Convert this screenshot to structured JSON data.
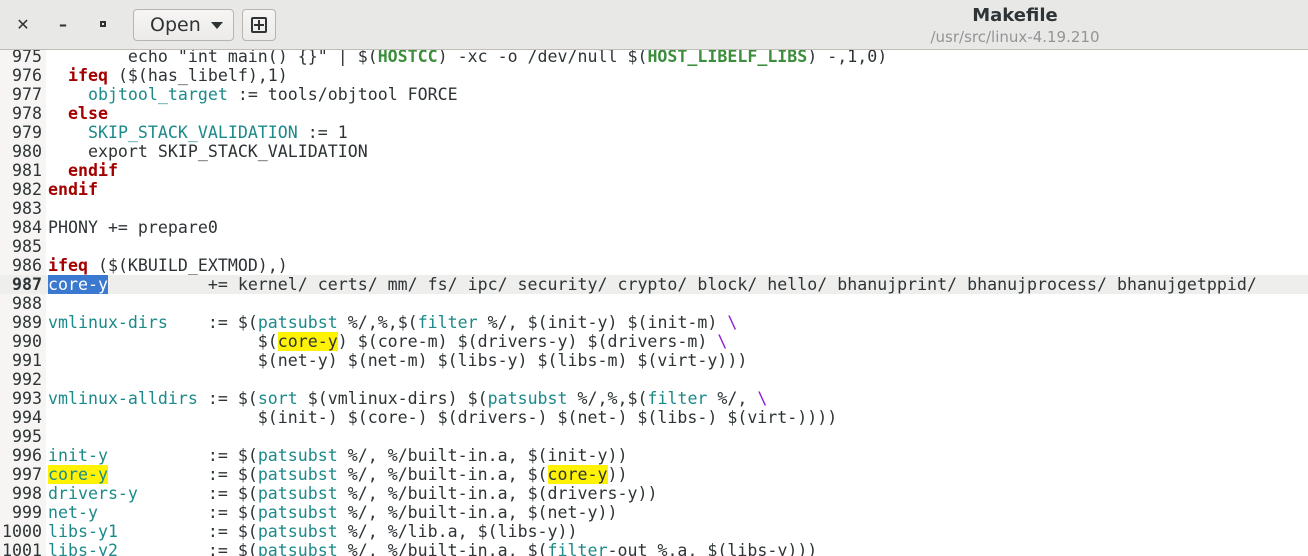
{
  "window": {
    "title": "Makefile",
    "subtitle": "/usr/src/linux-4.19.210",
    "close_symbol": "✕",
    "minimize_symbol": "–",
    "open_label": "Open",
    "icons": [
      "close-icon",
      "minimize-icon",
      "maximize-icon",
      "chevron-down-icon",
      "new-document-icon"
    ]
  },
  "editor": {
    "current_line": "987",
    "lines": [
      {
        "n": "975",
        "parts": [
          {
            "t": "        echo \"int main() {}\" | $("
          },
          {
            "t": "HOSTCC",
            "c": "mac"
          },
          {
            "t": ") -xc -o /dev/null $("
          },
          {
            "t": "HOST_LIBELF_LIBS",
            "c": "mac"
          },
          {
            "t": ") -,1,0)"
          }
        ]
      },
      {
        "n": "976",
        "parts": [
          {
            "t": "  "
          },
          {
            "t": "ifeq",
            "c": "kw"
          },
          {
            "t": " ($(has_libelf),1)"
          }
        ]
      },
      {
        "n": "977",
        "parts": [
          {
            "t": "    "
          },
          {
            "t": "objtool_target",
            "c": "var"
          },
          {
            "t": " := tools/objtool FORCE"
          }
        ]
      },
      {
        "n": "978",
        "parts": [
          {
            "t": "  "
          },
          {
            "t": "else",
            "c": "kw"
          }
        ]
      },
      {
        "n": "979",
        "parts": [
          {
            "t": "    "
          },
          {
            "t": "SKIP_STACK_VALIDATION",
            "c": "var"
          },
          {
            "t": " := 1"
          }
        ]
      },
      {
        "n": "980",
        "parts": [
          {
            "t": "    export SKIP_STACK_VALIDATION"
          }
        ]
      },
      {
        "n": "981",
        "parts": [
          {
            "t": "  "
          },
          {
            "t": "endif",
            "c": "kw"
          }
        ]
      },
      {
        "n": "982",
        "parts": [
          {
            "t": "endif",
            "c": "kw"
          }
        ]
      },
      {
        "n": "983",
        "parts": []
      },
      {
        "n": "984",
        "parts": [
          {
            "t": "PHONY += prepare0"
          }
        ]
      },
      {
        "n": "985",
        "parts": []
      },
      {
        "n": "986",
        "parts": [
          {
            "t": "ifeq",
            "c": "kw"
          },
          {
            "t": " ($(KBUILD_EXTMOD),)"
          }
        ]
      },
      {
        "n": "987",
        "parts": [
          {
            "t": "core-y",
            "c": "sel"
          },
          {
            "t": "          += kernel/ certs/ mm/ fs/ ipc/ security/ crypto/ block/ hello/ bhanujprint/ bhanujprocess/ bhanujgetppid/"
          }
        ]
      },
      {
        "n": "988",
        "parts": []
      },
      {
        "n": "989",
        "parts": [
          {
            "t": "vmlinux-dirs",
            "c": "var"
          },
          {
            "t": "    := $("
          },
          {
            "t": "patsubst",
            "c": "fn"
          },
          {
            "t": " %/,%,$("
          },
          {
            "t": "filter",
            "c": "fn"
          },
          {
            "t": " %/, $(init-y) $(init-m) "
          },
          {
            "t": "\\",
            "c": "bs"
          }
        ]
      },
      {
        "n": "990",
        "parts": [
          {
            "t": "                     $("
          },
          {
            "t": "core-y",
            "c": "hl"
          },
          {
            "t": ") $(core-m) $(drivers-y) $(drivers-m) "
          },
          {
            "t": "\\",
            "c": "bs"
          }
        ]
      },
      {
        "n": "991",
        "parts": [
          {
            "t": "                     $(net-y) $(net-m) $(libs-y) $(libs-m) $(virt-y)))"
          }
        ]
      },
      {
        "n": "992",
        "parts": []
      },
      {
        "n": "993",
        "parts": [
          {
            "t": "vmlinux-alldirs",
            "c": "var"
          },
          {
            "t": " := $("
          },
          {
            "t": "sort",
            "c": "fn"
          },
          {
            "t": " $(vmlinux-dirs) $("
          },
          {
            "t": "patsubst",
            "c": "fn"
          },
          {
            "t": " %/,%,$("
          },
          {
            "t": "filter",
            "c": "fn"
          },
          {
            "t": " %/, "
          },
          {
            "t": "\\",
            "c": "bs"
          }
        ]
      },
      {
        "n": "994",
        "parts": [
          {
            "t": "                     $(init-) $(core-) $(drivers-) $(net-) $(libs-) $(virt-))))"
          }
        ]
      },
      {
        "n": "995",
        "parts": []
      },
      {
        "n": "996",
        "parts": [
          {
            "t": "init-y",
            "c": "var"
          },
          {
            "t": "          := $("
          },
          {
            "t": "patsubst",
            "c": "fn"
          },
          {
            "t": " %/, %/built-in.a, $(init-y))"
          }
        ]
      },
      {
        "n": "997",
        "parts": [
          {
            "t": "core-y",
            "c": "hl var"
          },
          {
            "t": "          := $("
          },
          {
            "t": "patsubst",
            "c": "fn"
          },
          {
            "t": " %/, %/built-in.a, $("
          },
          {
            "t": "core-y",
            "c": "hl"
          },
          {
            "t": "))"
          }
        ]
      },
      {
        "n": "998",
        "parts": [
          {
            "t": "drivers-y",
            "c": "var"
          },
          {
            "t": "       := $("
          },
          {
            "t": "patsubst",
            "c": "fn"
          },
          {
            "t": " %/, %/built-in.a, $(drivers-y))"
          }
        ]
      },
      {
        "n": "999",
        "parts": [
          {
            "t": "net-y",
            "c": "var"
          },
          {
            "t": "           := $("
          },
          {
            "t": "patsubst",
            "c": "fn"
          },
          {
            "t": " %/, %/built-in.a, $(net-y))"
          }
        ]
      },
      {
        "n": "1000",
        "parts": [
          {
            "t": "libs-y1",
            "c": "var"
          },
          {
            "t": "         := $("
          },
          {
            "t": "patsubst",
            "c": "fn"
          },
          {
            "t": " %/, %/lib.a, $(libs-y))"
          }
        ]
      },
      {
        "n": "1001",
        "parts": [
          {
            "t": "libs-y2",
            "c": "var"
          },
          {
            "t": "         := $("
          },
          {
            "t": "patsubst",
            "c": "fn"
          },
          {
            "t": " %/, %/built-in.a, $("
          },
          {
            "t": "filter",
            "c": "fn"
          },
          {
            "t": "-out %.a, $(libs-y)))"
          }
        ]
      }
    ]
  }
}
